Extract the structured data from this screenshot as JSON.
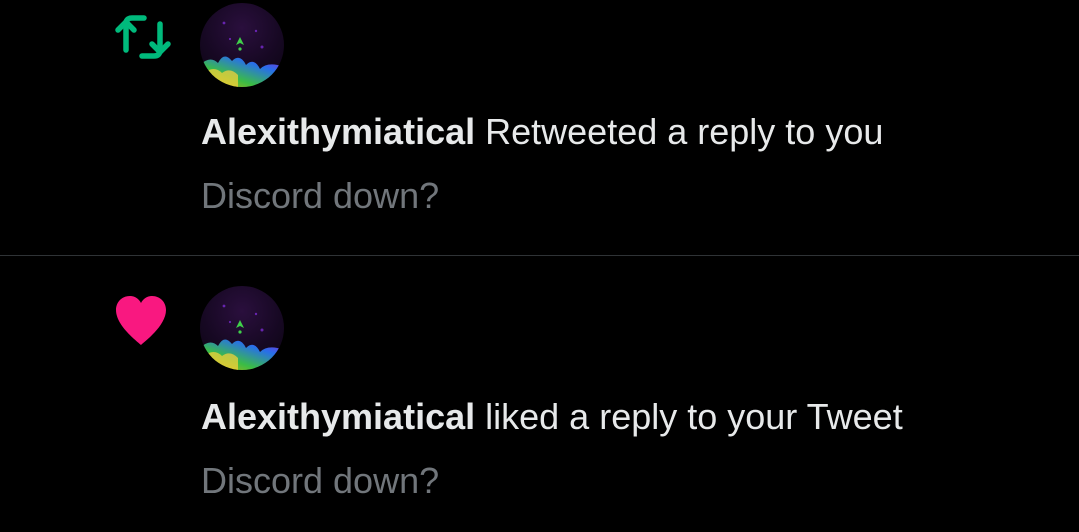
{
  "icons": {
    "retweet": "retweet-icon",
    "like": "heart-icon",
    "avatar": "user-avatar"
  },
  "colors": {
    "background": "#000000",
    "retweet_green": "#00ba7c",
    "like_pink": "#f91880",
    "primary_text": "#e7e9ea",
    "secondary_text": "#71767b"
  },
  "notifications": [
    {
      "type": "retweet",
      "user": "Alexithymiatical",
      "action": "Retweeted a reply to you",
      "tweet": "Discord down?"
    },
    {
      "type": "like",
      "user": "Alexithymiatical",
      "action": "liked a reply to your Tweet",
      "tweet": "Discord down?"
    }
  ]
}
